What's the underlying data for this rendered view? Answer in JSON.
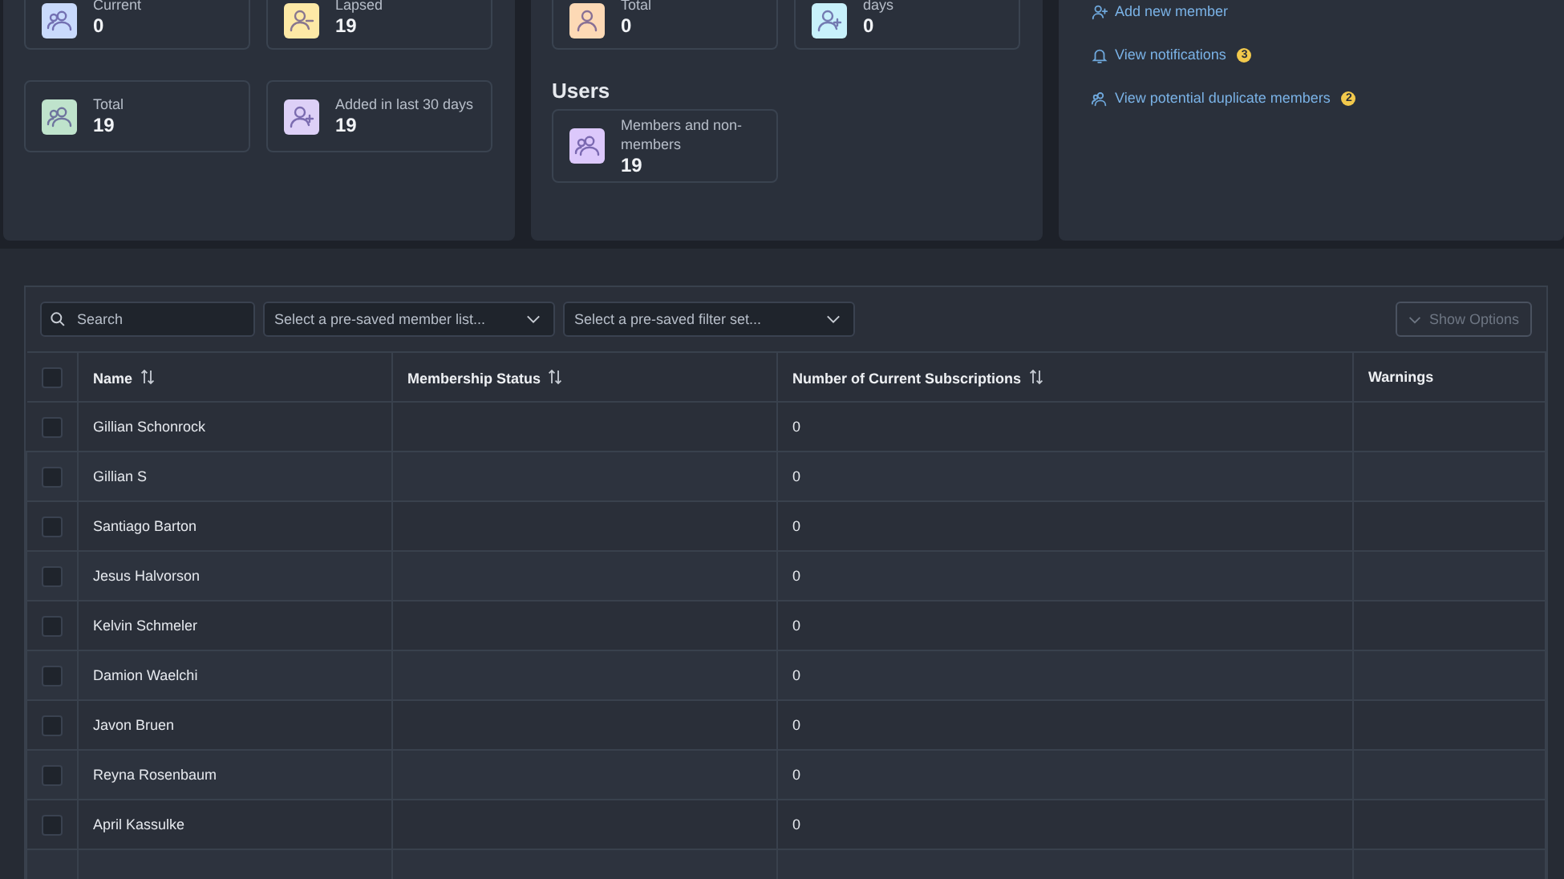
{
  "memberships": {
    "cards": [
      {
        "label": "Current",
        "value": "0",
        "kind": "group",
        "color": "#c9dafc"
      },
      {
        "label": "Lapsed",
        "value": "19",
        "kind": "person-minus",
        "color": "#fde9a6"
      },
      {
        "label": "Total",
        "value": "19",
        "kind": "group",
        "color": "#bfe3cc"
      },
      {
        "label": "Added in last 30 days",
        "value": "19",
        "kind": "person-plus",
        "color": "#ddd0f7"
      }
    ]
  },
  "subscriptions": {
    "cards": [
      {
        "label": "Total",
        "value": "0",
        "kind": "person",
        "color": "#fdd9b5"
      },
      {
        "label": "days",
        "value": "0",
        "kind": "person-plus",
        "color": "#c8f1fb"
      }
    ]
  },
  "users": {
    "heading": "Users",
    "cards": [
      {
        "label": "Members and non-members",
        "value": "19",
        "kind": "group",
        "color": "#dcc8fb"
      }
    ]
  },
  "links": [
    {
      "label": "Add new member",
      "kind": "person-plus"
    },
    {
      "label": "View notifications",
      "kind": "bell",
      "badge": "3"
    },
    {
      "label": "View potential duplicate members",
      "kind": "group",
      "badge": "2"
    }
  ],
  "table": {
    "search": {
      "placeholder": "Search"
    },
    "dropdowns": [
      {
        "placeholder": "Select a pre-saved member list..."
      },
      {
        "placeholder": "Select a pre-saved filter set..."
      }
    ],
    "options_button": {
      "label": "Show Options",
      "disabled": true
    },
    "select_all": {
      "checked": false
    },
    "columns": [
      {
        "label": "Name",
        "sortable": true
      },
      {
        "label": "Membership Status",
        "sortable": true
      },
      {
        "label": "Number of Current Subscriptions",
        "sortable": true
      },
      {
        "label": "Warnings",
        "sortable": false
      }
    ],
    "rows": [
      {
        "name": "Gillian Schonrock",
        "subscriptions": "0",
        "checked": false
      },
      {
        "name": "Gillian S",
        "subscriptions": "0",
        "checked": false
      },
      {
        "name": "Santiago Barton",
        "subscriptions": "0",
        "checked": false
      },
      {
        "name": "Jesus Halvorson",
        "subscriptions": "0",
        "checked": false
      },
      {
        "name": "Kelvin Schmeler",
        "subscriptions": "0",
        "checked": false
      },
      {
        "name": "Damion Waelchi",
        "subscriptions": "0",
        "checked": false
      },
      {
        "name": "Javon Bruen",
        "subscriptions": "0",
        "checked": false
      },
      {
        "name": "Reyna Rosenbaum",
        "subscriptions": "0",
        "checked": false
      },
      {
        "name": "April Kassulke",
        "subscriptions": "0",
        "checked": false
      }
    ]
  }
}
